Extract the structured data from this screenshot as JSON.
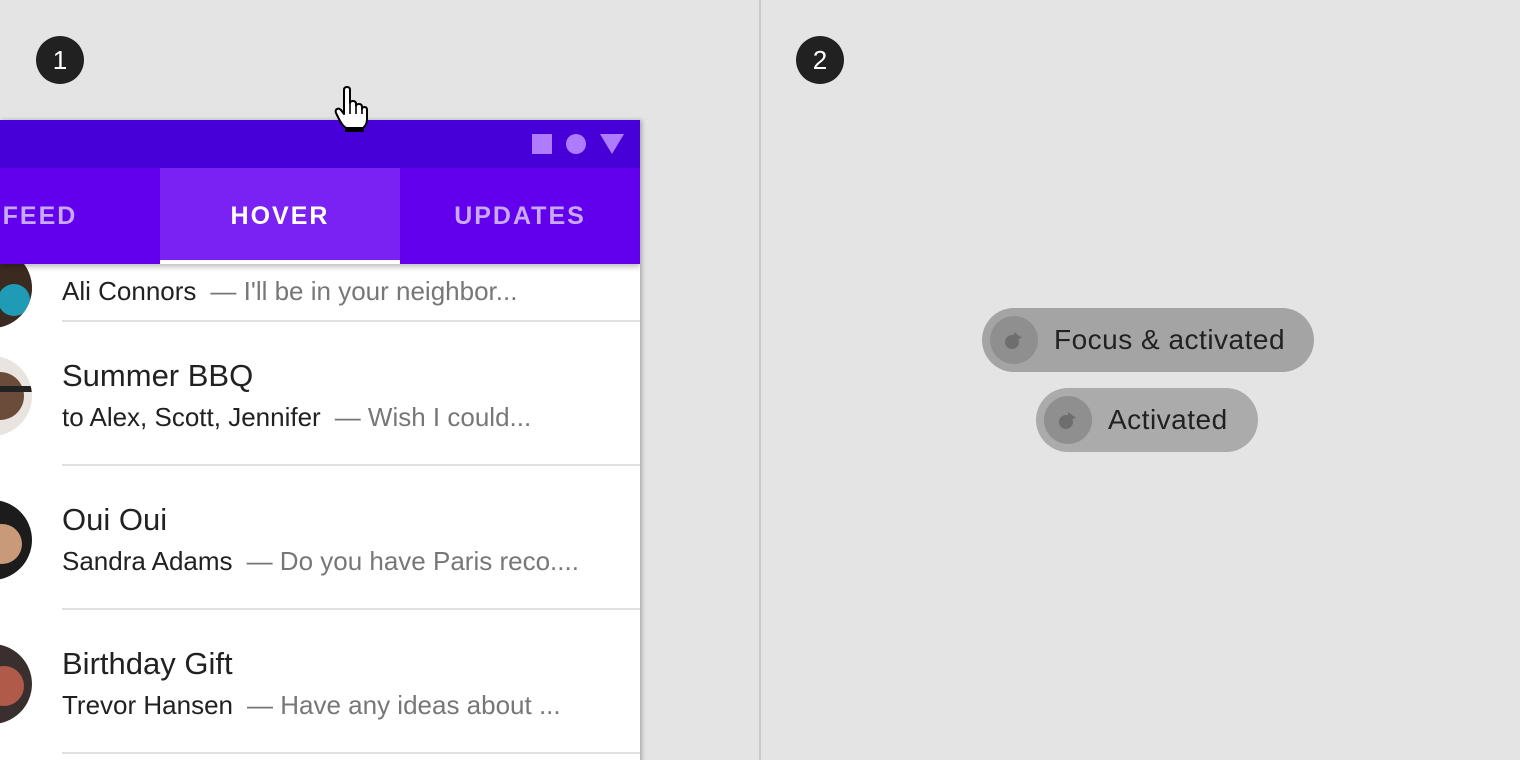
{
  "steps": {
    "left": "1",
    "right": "2"
  },
  "colors": {
    "status_bar": "#4800d8",
    "tab_bar": "#6200ee",
    "tab_hover": "#7a22f3",
    "tab_inactive_text": "#c9a8ff",
    "background": "#e4e4e4",
    "chip": "#ababab"
  },
  "status_bar": {
    "icons": [
      "square-icon",
      "circle-icon",
      "triangle-icon"
    ]
  },
  "tabs": [
    {
      "label": "FEED",
      "state": "inactive"
    },
    {
      "label": "HOVER",
      "state": "hover-selected"
    },
    {
      "label": "UPDATES",
      "state": "inactive"
    }
  ],
  "list": [
    {
      "title": "",
      "sender": "Ali Connors",
      "preview": "— I'll be in your neighbor..."
    },
    {
      "title": "Summer BBQ",
      "sender": "to Alex, Scott, Jennifer",
      "preview": "— Wish I could..."
    },
    {
      "title": "Oui Oui",
      "sender": "Sandra Adams",
      "preview": "— Do you have Paris reco...."
    },
    {
      "title": "Birthday Gift",
      "sender": "Trevor Hansen",
      "preview": "— Have any ideas about ..."
    }
  ],
  "chips": [
    {
      "label": "Focus & activated",
      "icon": "avatar-placeholder-icon"
    },
    {
      "label": "Activated",
      "icon": "avatar-placeholder-icon"
    }
  ]
}
